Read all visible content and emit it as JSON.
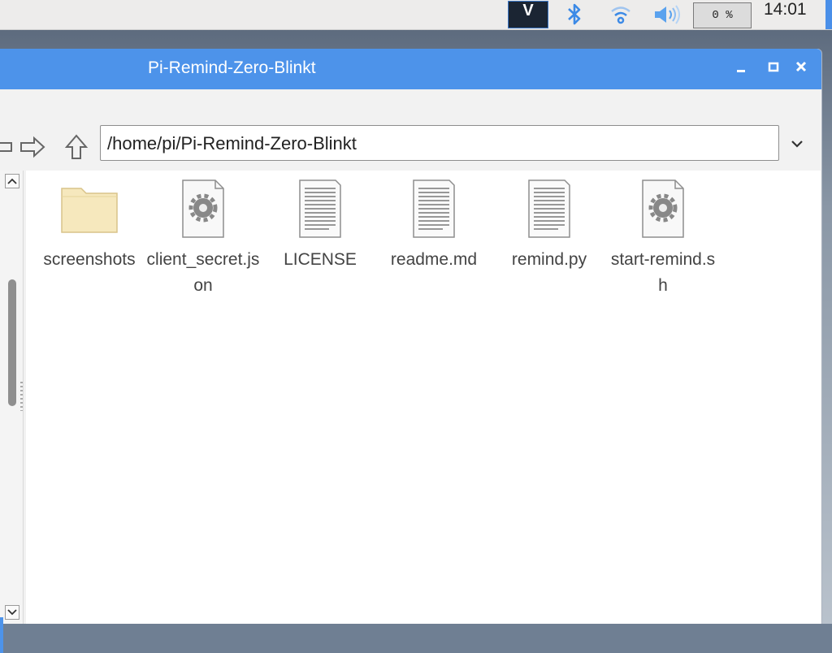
{
  "taskbar": {
    "cpu_usage": "0 %",
    "clock": "14:01",
    "icons": [
      "vnc-icon",
      "bluetooth-icon",
      "wifi-icon",
      "volume-icon"
    ],
    "vnc_label": "V"
  },
  "window": {
    "title": "Pi-Remind-Zero-Blinkt",
    "controls": {
      "minimize": "_",
      "maximize": "□",
      "close": "✕"
    }
  },
  "toolbar": {
    "path": "/home/pi/Pi-Remind-Zero-Blinkt"
  },
  "files": [
    {
      "name": "screenshots",
      "icon": "folder-icon"
    },
    {
      "name": "client_secret.json",
      "icon": "gear-file-icon"
    },
    {
      "name": "LICENSE",
      "icon": "text-file-icon"
    },
    {
      "name": "readme.md",
      "icon": "text-file-icon"
    },
    {
      "name": "remind.py",
      "icon": "text-file-icon"
    },
    {
      "name": "start-remind.sh",
      "icon": "gear-file-icon"
    }
  ],
  "colors": {
    "titlebar": "#4d93ea",
    "folder": "#f5e6b8"
  }
}
